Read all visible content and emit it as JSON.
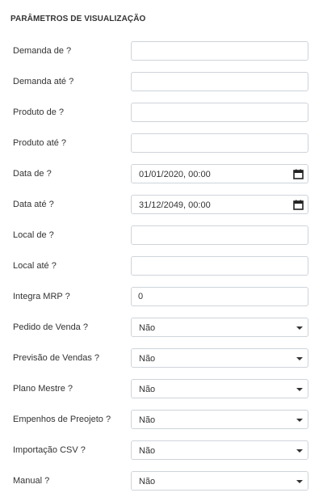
{
  "section_title": "PARÂMETROS DE VISUALIZAÇÃO",
  "text_fields": [
    {
      "label": "Demanda de ?",
      "value": ""
    },
    {
      "label": "Demanda até ?",
      "value": ""
    },
    {
      "label": "Produto de ?",
      "value": ""
    },
    {
      "label": "Produto até ?",
      "value": ""
    }
  ],
  "date_fields": [
    {
      "label": "Data de ?",
      "value": "01/01/2020, 00:00",
      "icon": "calendar-icon"
    },
    {
      "label": "Data até ?",
      "value": "31/12/2049, 00:00",
      "icon": "calendar-icon"
    }
  ],
  "local_fields": [
    {
      "label": "Local de ?",
      "value": ""
    },
    {
      "label": "Local até ?",
      "value": ""
    }
  ],
  "number_field": {
    "label": "Integra MRP ?",
    "value": "0"
  },
  "select_fields": [
    {
      "label": "Pedido de Venda ?",
      "selected": "Não"
    },
    {
      "label": "Previsão de Vendas ?",
      "selected": "Não"
    },
    {
      "label": "Plano Mestre ?",
      "selected": "Não"
    },
    {
      "label": "Empenhos de Preojeto ?",
      "selected": "Não"
    },
    {
      "label": "Importação CSV ?",
      "selected": "Não"
    },
    {
      "label": "Manual ?",
      "selected": "Não"
    }
  ],
  "colors": {
    "border": "#ced4da",
    "text": "#333333",
    "background": "#ffffff"
  }
}
